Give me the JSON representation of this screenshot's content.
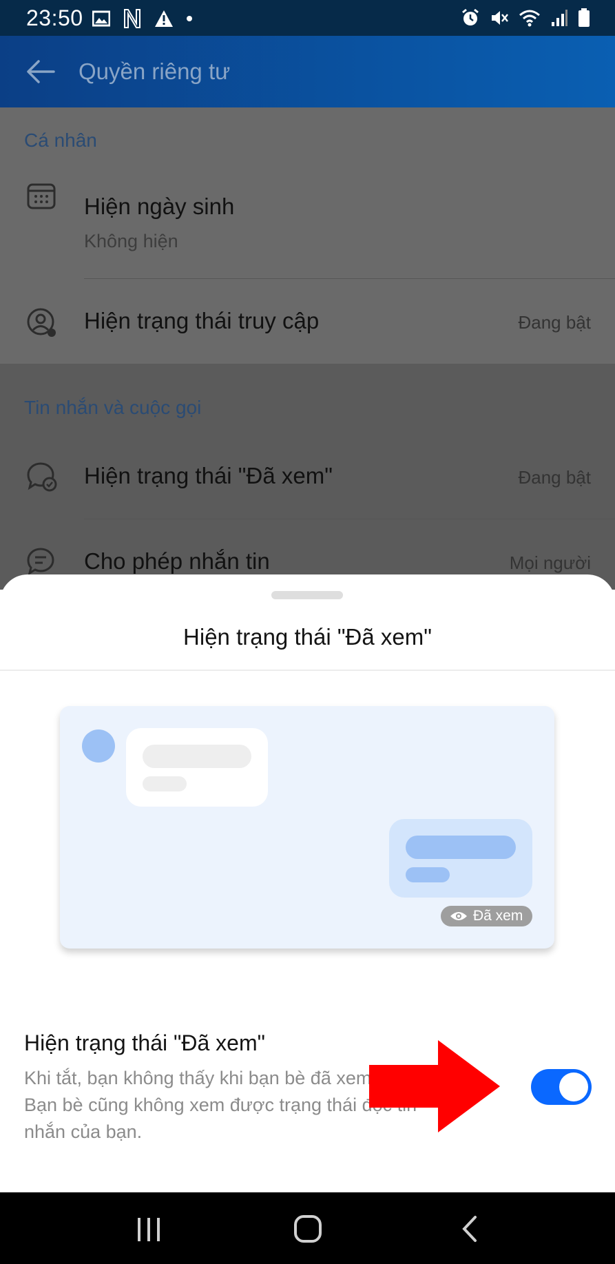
{
  "status_bar": {
    "time": "23:50",
    "left_icons": [
      "image-icon",
      "notification-n-icon",
      "warning-icon",
      "dot-icon"
    ],
    "right_icons": [
      "alarm-icon",
      "mute-icon",
      "wifi-icon",
      "signal-icon",
      "battery-icon"
    ]
  },
  "app_bar": {
    "title": "Quyền riêng tư"
  },
  "sections": {
    "personal": {
      "label": "Cá nhân",
      "birthday": {
        "title": "Hiện ngày sinh",
        "subtitle": "Không hiện"
      },
      "access_status": {
        "title": "Hiện trạng thái truy cập",
        "value": "Đang bật"
      }
    },
    "messages": {
      "label": "Tin nhắn và cuộc gọi",
      "seen_status": {
        "title": "Hiện trạng thái \"Đã xem\"",
        "value": "Đang bật"
      },
      "allow_messages": {
        "title": "Cho phép nhắn tin",
        "value": "Mọi người"
      }
    }
  },
  "sheet": {
    "title": "Hiện trạng thái \"Đã xem\"",
    "illustration_badge": "Đã xem",
    "setting_title": "Hiện trạng thái \"Đã xem\"",
    "setting_description": "Khi tắt, bạn không thấy khi bạn bè đã xem tin. Bạn bè cũng không xem được trạng thái đọc tin nhắn của bạn.",
    "toggle_on": true
  },
  "colors": {
    "accent": "#0a68ff",
    "app_bar": "#0b4f9c",
    "annotation_arrow": "#ff0000"
  },
  "nav_bar": {
    "icons": [
      "recent-apps-icon",
      "home-icon",
      "back-icon"
    ]
  }
}
